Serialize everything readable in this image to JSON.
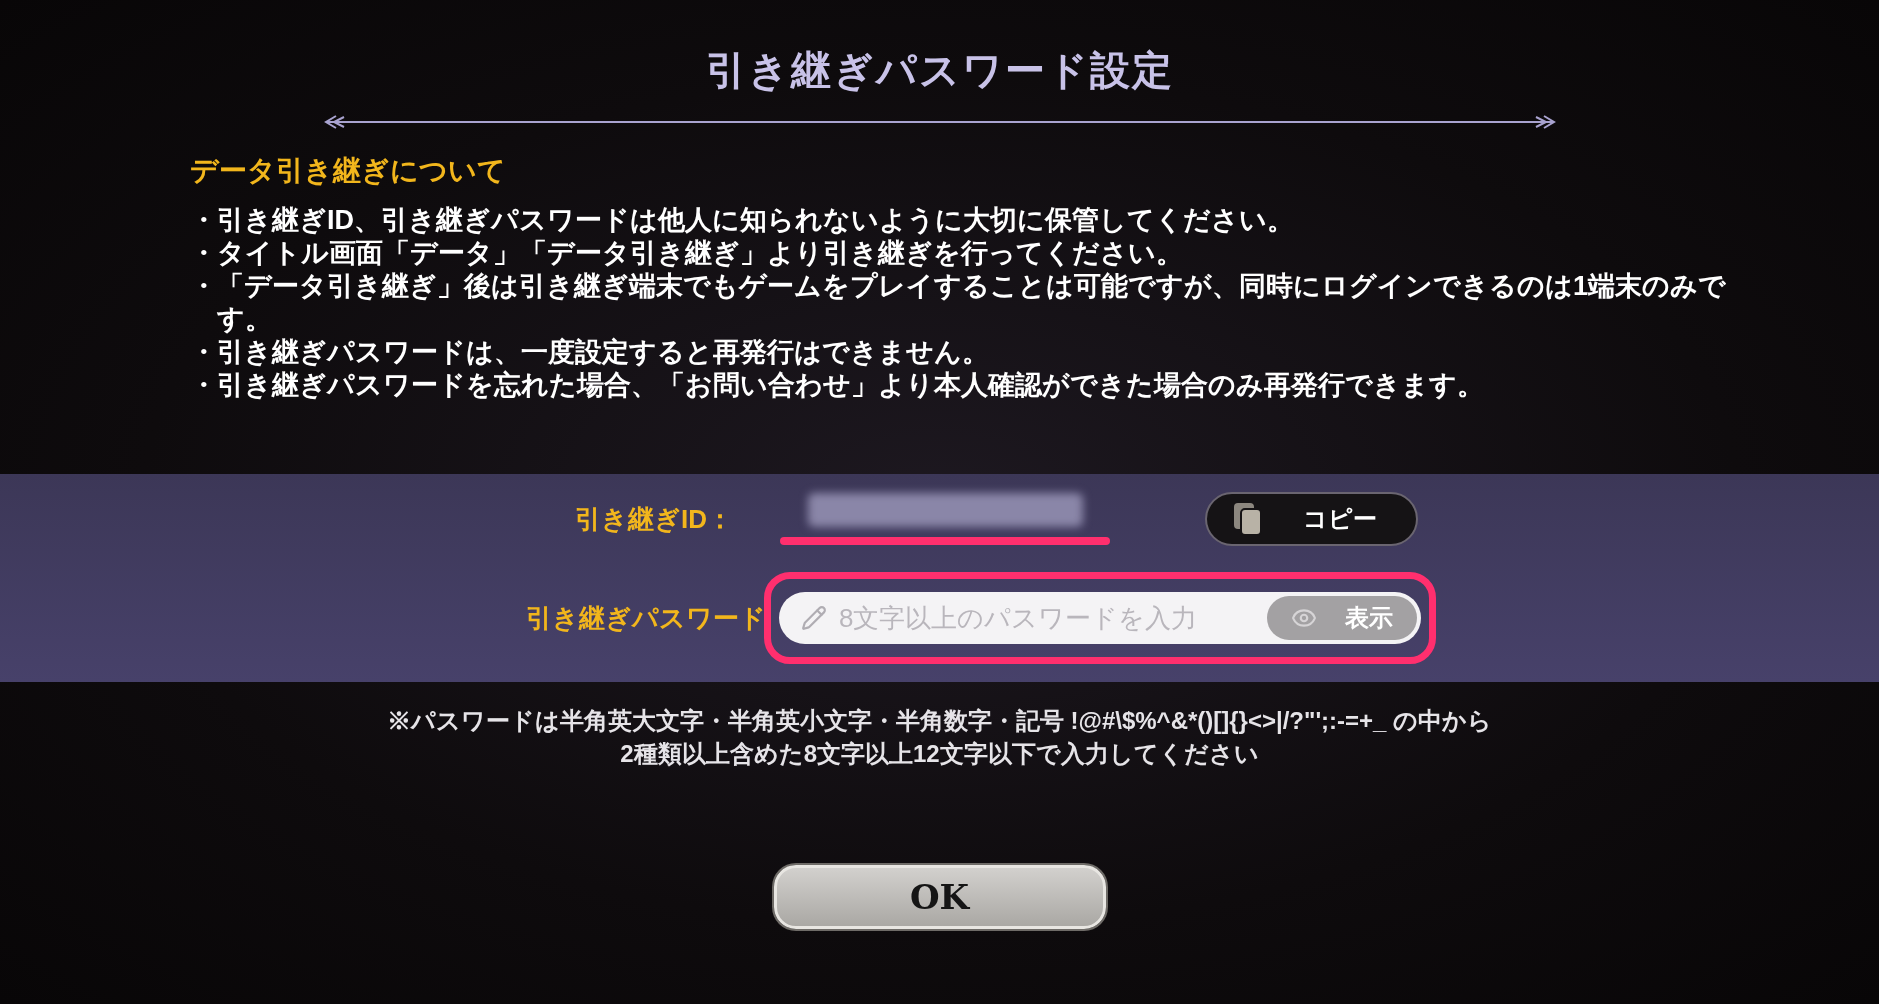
{
  "title": "引き継ぎパスワード設定",
  "about": {
    "heading": "データ引き継ぎについて",
    "items": [
      "・引き継ぎID、引き継ぎパスワードは他人に知られないように大切に保管してください。",
      "・タイトル画面「データ」「データ引き継ぎ」より引き継ぎを行ってください。",
      "・「データ引き継ぎ」後は引き継ぎ端末でもゲームをプレイすることは可能ですが、同時にログインできるのは1端末のみです。",
      "・引き継ぎパスワードは、一度設定すると再発行はできません。",
      "・引き継ぎパスワードを忘れた場合、「お問い合わせ」より本人確認ができた場合のみ再発行できます。"
    ]
  },
  "id_row": {
    "label": "引き継ぎID：",
    "copy_button": "コピー"
  },
  "password_row": {
    "label": "引き継ぎパスワード",
    "placeholder": "8文字以上のパスワードを入力",
    "show_button": "表示"
  },
  "note": [
    "※パスワードは半角英大文字・半角英小文字・半角数字・記号 !@#\\$%^&*()[]{}<>|/?\"';:-=+_ の中から",
    "2種類以上含めた8文字以上12文字以下で入力してください"
  ],
  "ok_button": "OK"
}
